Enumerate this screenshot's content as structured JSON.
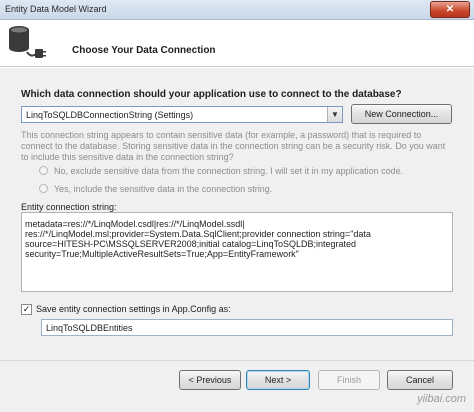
{
  "window": {
    "title": "Entity Data Model Wizard",
    "close": "✕"
  },
  "header": {
    "heading": "Choose Your Data Connection"
  },
  "connection": {
    "question": "Which data connection should your application use to connect to the database?",
    "selected": "LinqToSQLDBConnectionString (Settings)",
    "new_connection_label": "New Connection...",
    "warning": "This connection string appears to contain sensitive data (for example, a password) that is required to connect to the database. Storing sensitive data in the connection string can be a security risk. Do you want to include this sensitive data in the connection string?",
    "option_no": "No, exclude sensitive data from the connection string. I will set it in my application code.",
    "option_yes": "Yes, include the sensitive data in the connection string.",
    "string_label": "Entity connection string:",
    "string_value": "metadata=res://*/LinqModel.csdl|res://*/LinqModel.ssdl|\nres://*/LinqModel.msl;provider=System.Data.SqlClient;provider connection string=\"data\nsource=HITESH-PC\\MSSQLSERVER2008;initial catalog=LinqToSQLDB;integrated\nsecurity=True;MultipleActiveResultSets=True;App=EntityFramework\""
  },
  "settings": {
    "save_checked": true,
    "checkmark": "✓",
    "save_label": "Save entity connection settings in App.Config as:",
    "entities_name": "LinqToSQLDBEntities"
  },
  "footer": {
    "previous_label": "< Previous",
    "next_label": "Next >",
    "finish_label": "Finish",
    "cancel_label": "Cancel"
  },
  "watermark": "yiibai.com"
}
